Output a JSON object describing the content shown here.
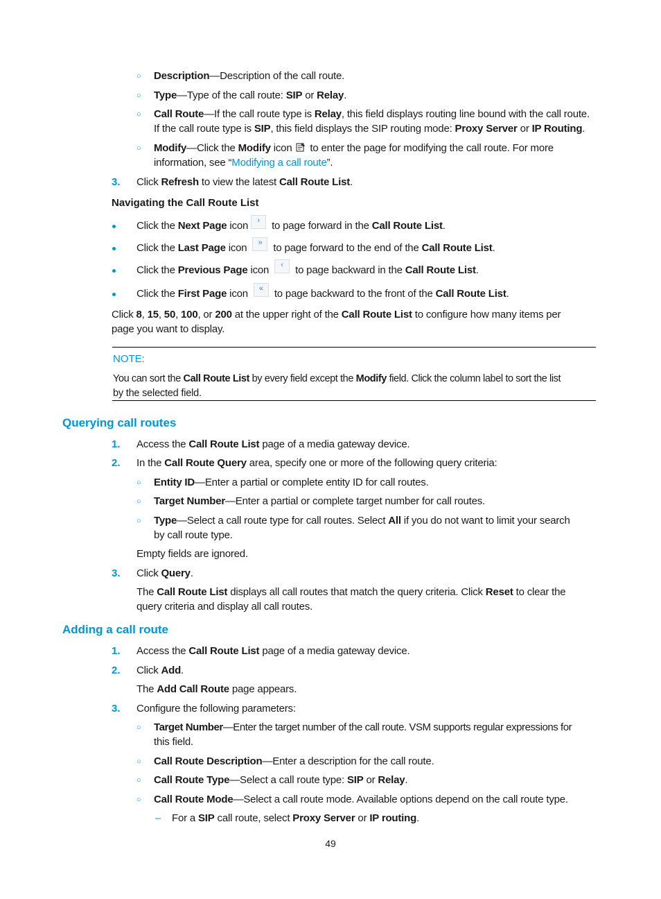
{
  "section_intro_items": [
    {
      "term": "Description",
      "text": "—Description of the call route."
    },
    {
      "term": "Type",
      "text_before": "—Type of the call route: ",
      "opt1": "SIP",
      "mid": " or ",
      "opt2": "Relay",
      "end": "."
    },
    {
      "term": "Call Route",
      "line1_a": "—If the call route type is ",
      "line1_b": "Relay",
      "line1_c": ", this field displays routing line bound with the call route.",
      "line2_a": "If the call route type is ",
      "line2_b": "SIP",
      "line2_c": ", this field displays the SIP routing mode: ",
      "line2_d": "Proxy Server",
      "line2_e": " or ",
      "line2_f": "IP Routing",
      "line2_g": "."
    },
    {
      "term": "Modify",
      "line1_a": "—Click the ",
      "line1_b": "Modify",
      "line1_c": " icon ",
      "icon": "modify-icon",
      "line1_d": " to enter the page for modifying the call route. For more",
      "line2_a": "information, see “",
      "link": "Modifying a call route",
      "line2_b": "”."
    }
  ],
  "step3_refresh": {
    "num": "3.",
    "a": "Click ",
    "b": "Refresh",
    "c": " to view the latest ",
    "d": "Call Route List",
    "e": "."
  },
  "nav": {
    "title": "Navigating the Call Route List",
    "items": [
      {
        "a": "Click the ",
        "b": "Next Page",
        "c": " icon",
        "icon": "›",
        "icon_name": "next-page-icon",
        "d": "to page forward in the ",
        "e": "Call Route List",
        "f": "."
      },
      {
        "a": "Click the ",
        "b": "Last Page",
        "c": " icon",
        "icon": "»",
        "icon_name": "last-page-icon",
        "d": "to page forward to the end of the ",
        "e": "Call Route List",
        "f": "."
      },
      {
        "a": "Click the ",
        "b": "Previous Page",
        "c": " icon",
        "icon": "‹",
        "icon_name": "previous-page-icon",
        "d": "to page backward in the ",
        "e": "Call Route List",
        "f": "."
      },
      {
        "a": "Click the ",
        "b": "First Page",
        "c": " icon",
        "icon": "«",
        "icon_name": "first-page-icon",
        "d": "to page backward to the front of the ",
        "e": "Call Route List",
        "f": "."
      }
    ],
    "pagesize": {
      "a": "Click ",
      "n1": "8",
      "s1": ", ",
      "n2": "15",
      "s2": ", ",
      "n3": "50",
      "s3": ", ",
      "n4": "100",
      "s4": ", or ",
      "n5": "200",
      "b": " at the upper right of the ",
      "c": "Call Route List",
      "d": " to configure how many items per",
      "line2": "page you want to display."
    }
  },
  "note": {
    "label": "NOTE:",
    "a": "You can sort the ",
    "b": "Call Route List",
    "c": " by every field except the ",
    "d": "Modify",
    "e": " field. Click the column label to sort the list",
    "line2": "by the selected field."
  },
  "querying": {
    "heading": "Querying call routes",
    "step1": {
      "num": "1.",
      "a": "Access the ",
      "b": "Call Route List",
      "c": " page of a media gateway device."
    },
    "step2": {
      "num": "2.",
      "a": "In the ",
      "b": "Call Route Query",
      "c": " area, specify one or more of the following query criteria:"
    },
    "criteria": [
      {
        "term": "Entity ID",
        "text": "—Enter a partial or complete entity ID for call routes."
      },
      {
        "term": "Target Number",
        "text": "—Enter a partial or complete target number for call routes."
      },
      {
        "term": "Type",
        "a": "—Select a call route type for call routes. Select ",
        "b": "All",
        "c": " if you do not want to limit your search",
        "line2": "by call route type."
      }
    ],
    "empty_note": "Empty fields are ignored.",
    "step3": {
      "num": "3.",
      "a": "Click ",
      "b": "Query",
      "c": "."
    },
    "result": {
      "a": "The ",
      "b": "Call Route List",
      "c": " displays all call routes that match the query criteria. Click ",
      "d": "Reset",
      "e": " to clear the",
      "line2": "query criteria and display all call routes."
    }
  },
  "adding": {
    "heading": "Adding a call route",
    "step1": {
      "num": "1.",
      "a": "Access the ",
      "b": "Call Route List",
      "c": " page of a media gateway device."
    },
    "step2": {
      "num": "2.",
      "a": "Click ",
      "b": "Add",
      "c": "."
    },
    "appears": {
      "a": "The ",
      "b": "Add Call Route",
      "c": " page appears."
    },
    "step3": {
      "num": "3.",
      "a": "Configure the following parameters:"
    },
    "params": [
      {
        "term": "Target Number",
        "text": "—Enter the target number of the call route. VSM supports regular expressions for",
        "line2": "this field."
      },
      {
        "term": "Call Route Description",
        "text": "—Enter a description for the call route."
      },
      {
        "term": "Call Route Type",
        "a": "—Select a call route type: ",
        "b": "SIP",
        "c": " or ",
        "d": "Relay",
        "e": "."
      },
      {
        "term": "Call Route Mode",
        "text": "—Select a call route mode. Available options depend on the call route type."
      }
    ],
    "sub": {
      "a": "For a ",
      "b": "SIP",
      "c": " call route, select ",
      "d": "Proxy Server",
      "e": " or ",
      "f": "IP routing",
      "g": "."
    }
  },
  "page_number": "49"
}
